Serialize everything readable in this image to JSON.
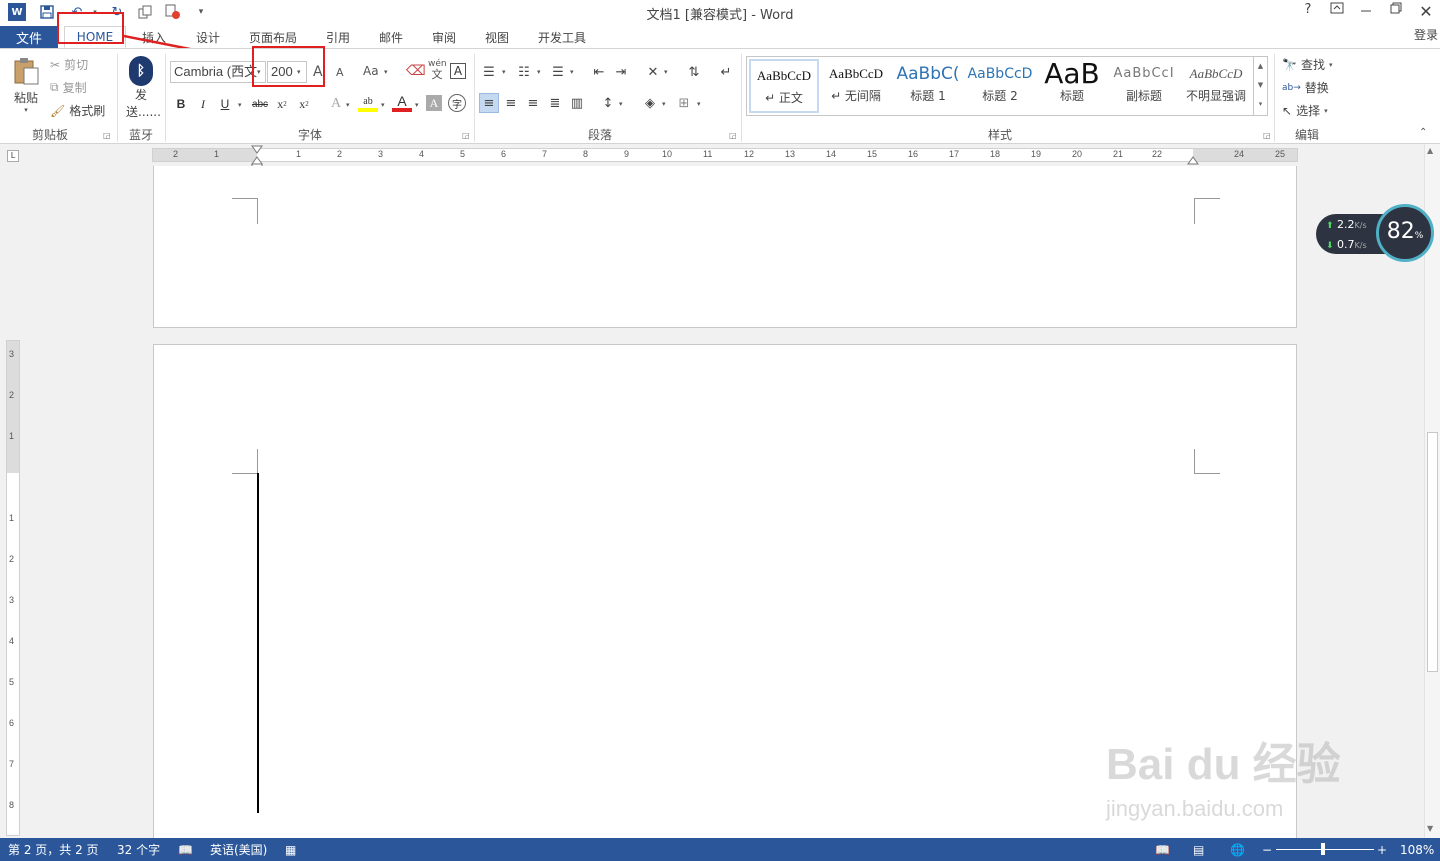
{
  "window": {
    "title": "文档1 [兼容模式] - Word",
    "help": "?",
    "login": "登录"
  },
  "tabs": {
    "file": "文件",
    "items": [
      "HOME",
      "插入",
      "设计",
      "页面布局",
      "引用",
      "邮件",
      "审阅",
      "视图",
      "开发工具"
    ]
  },
  "clipboard": {
    "paste": "粘贴",
    "cut": "剪切",
    "copy": "复制",
    "format_painter": "格式刷",
    "group": "剪贴板"
  },
  "bluetooth": {
    "send_line1": "发",
    "send_line2": "送......",
    "group": "蓝牙"
  },
  "font": {
    "name": "Cambria (西文",
    "size": "200",
    "grow": "A",
    "shrink": "A",
    "case": "Aa",
    "wen": "wén",
    "wen_char": "文",
    "border_a": "A",
    "bold": "B",
    "italic": "I",
    "underline": "U",
    "strike": "abc",
    "subscript": "x",
    "sub_small": "2",
    "superscript": "x",
    "sup_small": "2",
    "effects": "A",
    "highlight": "ab",
    "color": "A",
    "shade": "A",
    "circle": "字",
    "group": "字体"
  },
  "paragraph": {
    "group": "段落"
  },
  "styles": {
    "items": [
      {
        "preview": "AaBbCcD",
        "name": "↵ 正文"
      },
      {
        "preview": "AaBbCcD",
        "name": "↵ 无间隔"
      },
      {
        "preview": "AaBbC(",
        "name": "标题 1"
      },
      {
        "preview": "AaBbCcD",
        "name": "标题 2"
      },
      {
        "preview": "AaB",
        "name": "标题"
      },
      {
        "preview": "AaBbCcI",
        "name": "副标题"
      },
      {
        "preview": "AaBbCcD",
        "name": "不明显强调"
      }
    ],
    "group": "样式"
  },
  "editing": {
    "find": "查找",
    "replace": "替换",
    "select": "选择",
    "group": "编辑"
  },
  "ruler": {
    "h_numbers": [
      "2",
      "1",
      "1",
      "2",
      "3",
      "4",
      "5",
      "6",
      "7",
      "8",
      "9",
      "10",
      "11",
      "12",
      "13",
      "14",
      "15",
      "16",
      "17",
      "18",
      "19",
      "20",
      "21",
      "22",
      "24",
      "25"
    ],
    "v_numbers": [
      "3",
      "2",
      "1",
      "1",
      "2",
      "3",
      "4",
      "5",
      "6",
      "7",
      "8"
    ]
  },
  "network_widget": {
    "up": "2.2",
    "down": "0.7",
    "unit": "K/s",
    "percent": "82",
    "pct_sign": "%"
  },
  "status": {
    "page": "第 2 页，共 2 页",
    "words": "32 个字",
    "language": "英语(美国)",
    "zoom": "108%"
  },
  "watermark": {
    "brand": "Bai du 经验",
    "url": "jingyan.baidu.com"
  },
  "colors": {
    "accent": "#2b579a",
    "annotation": "#e02020"
  }
}
